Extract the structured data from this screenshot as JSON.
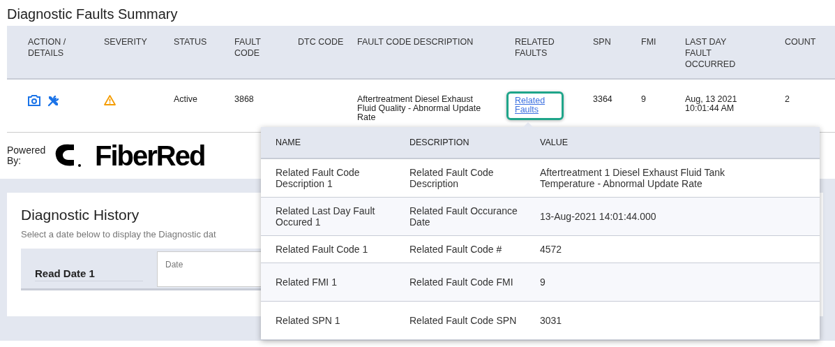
{
  "title": "Diagnostic Faults Summary",
  "faults_table": {
    "columns": [
      "ACTION / DETAILS",
      "SEVERITY",
      "STATUS",
      "FAULT CODE",
      "DTC CODE",
      "FAULT CODE DESCRIPTION",
      "RELATED FAULTS",
      "SPN",
      "FMI",
      "LAST DAY FAULT OCCURRED",
      "COUNT"
    ],
    "rows": [
      {
        "status": "Active",
        "fault_code": "3868",
        "description": "Aftertreatment Diesel Exhaust Fluid Quality - Abnormal Update Rate",
        "related": {
          "label": "Related Faults",
          "focused": true
        },
        "spn": "3364",
        "fmi": "9",
        "last_occurred": "Aug, 13 2021 10:01:44 AM",
        "count": "2"
      }
    ]
  },
  "powered_by": {
    "label": "Powered By:",
    "logo_text": "FiberRed"
  },
  "history": {
    "title": "Diagnostic History",
    "hint": "Select a date below to display the Diagnostic dat",
    "read_date": {
      "label": "Read Date 1",
      "placeholder": "Date"
    }
  },
  "related_faults_popup": {
    "columns": [
      "NAME",
      "DESCRIPTION",
      "VALUE"
    ],
    "rows": [
      {
        "name": "Related Fault Code Description 1",
        "description": "Related Fault Code Description",
        "value": "Aftertreatment 1 Diesel Exhaust Fluid Tank Temperature - Abnormal Update Rate"
      },
      {
        "name": "Related Last Day Fault Occured 1",
        "description": "Related Fault Occurance Date",
        "value": "13-Aug-2021 14:01:44.000"
      },
      {
        "name": "Related Fault Code 1",
        "description": "Related Fault Code #",
        "value": "4572"
      },
      {
        "name": "Related FMI 1",
        "description": "Related Fault Code FMI",
        "value": "9"
      },
      {
        "name": "Related SPN 1",
        "description": "Related Fault Code SPN",
        "value": "3031"
      }
    ]
  }
}
